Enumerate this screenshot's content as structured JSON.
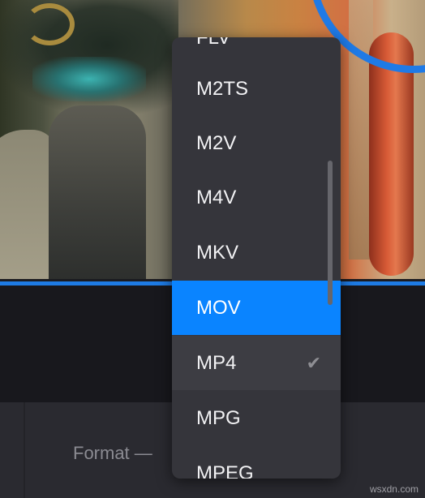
{
  "dropdown": {
    "items": [
      {
        "label": "FLV"
      },
      {
        "label": "M2TS"
      },
      {
        "label": "M2V"
      },
      {
        "label": "M4V"
      },
      {
        "label": "MKV"
      },
      {
        "label": "MOV",
        "state": "highlighted"
      },
      {
        "label": "MP4",
        "state": "selected"
      },
      {
        "label": "MPG"
      },
      {
        "label": "MPEG"
      }
    ],
    "check_icon": "✔"
  },
  "settings": {
    "format_label": "Format —"
  },
  "watermark": "wsxdn.com",
  "colors": {
    "accent": "#0a84ff",
    "menu_bg": "#35353b",
    "progress": "#1e7be4"
  }
}
